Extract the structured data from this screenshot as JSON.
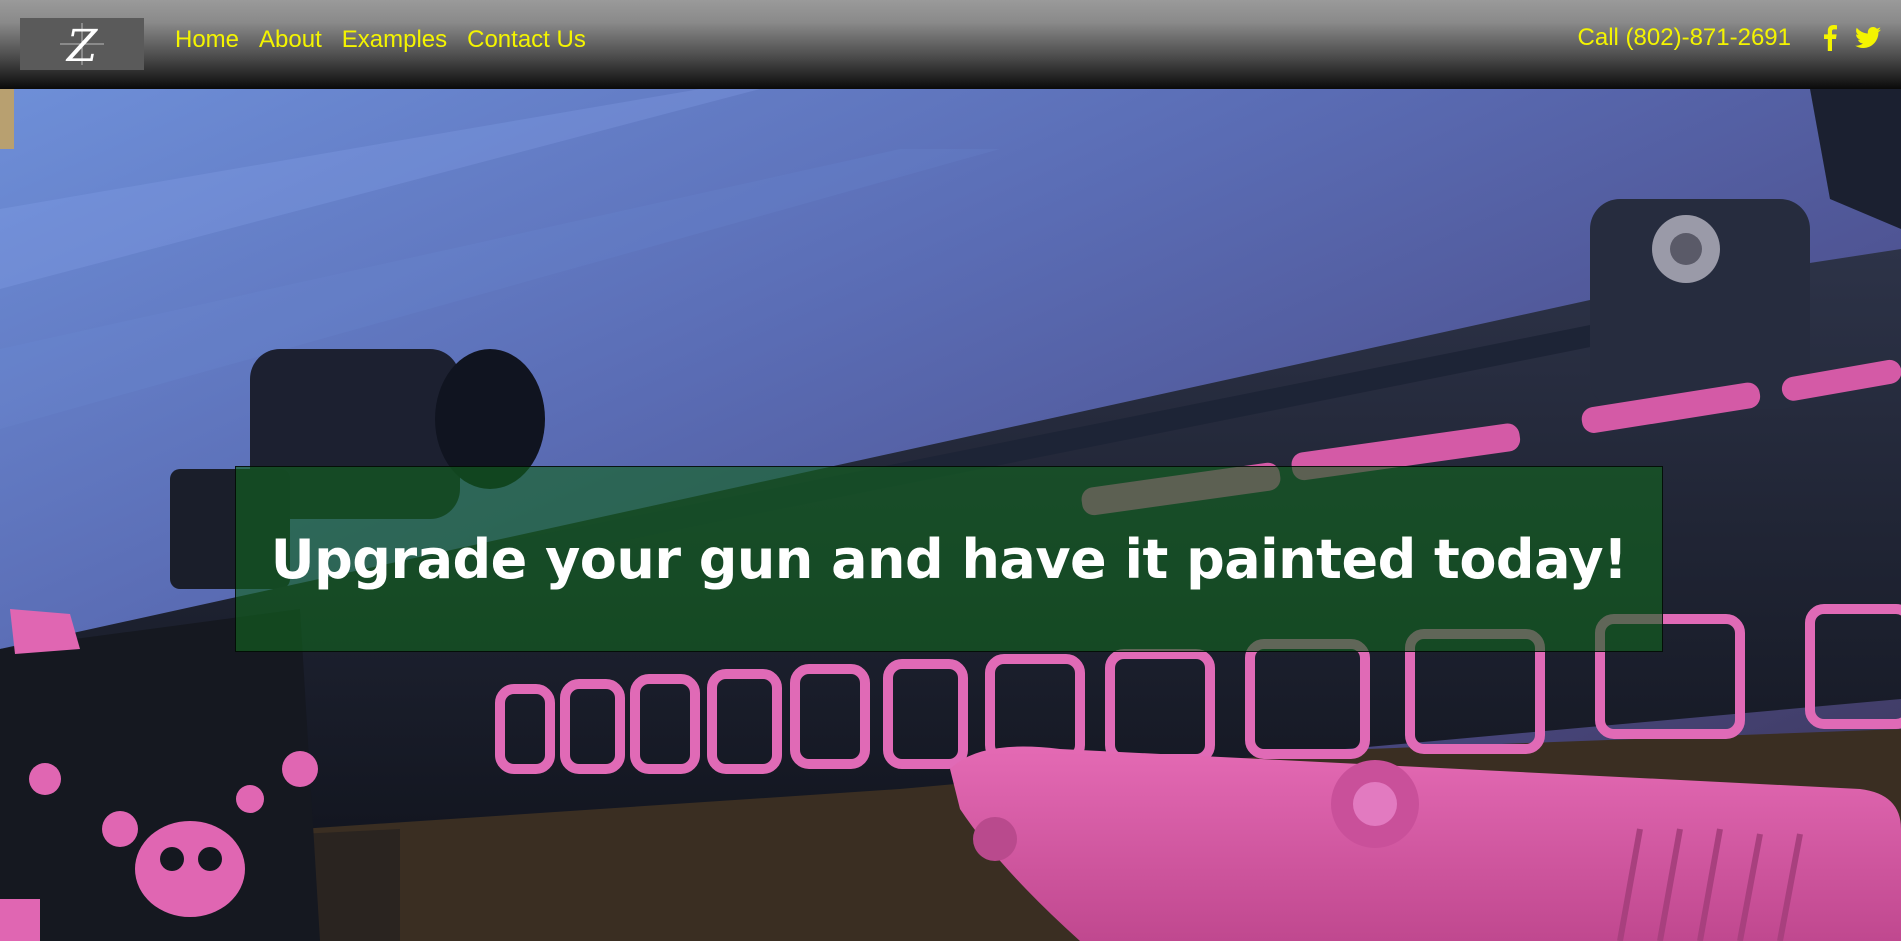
{
  "header": {
    "logo_letter": "Z",
    "nav": [
      {
        "label": "Home"
      },
      {
        "label": "About"
      },
      {
        "label": "Examples"
      },
      {
        "label": "Contact Us"
      }
    ],
    "phone": "Call (802)-871-2691",
    "social": [
      {
        "icon": "facebook-icon"
      },
      {
        "icon": "twitter-icon"
      }
    ]
  },
  "hero": {
    "headline": "Upgrade your gun and have it painted today!",
    "image_subject": "pink and black painted rifle on wooden table"
  },
  "colors": {
    "nav_text": "#f4f400",
    "banner_bg": "rgba(18,100,30,0.62)",
    "accent_pink": "#e05aa8"
  }
}
